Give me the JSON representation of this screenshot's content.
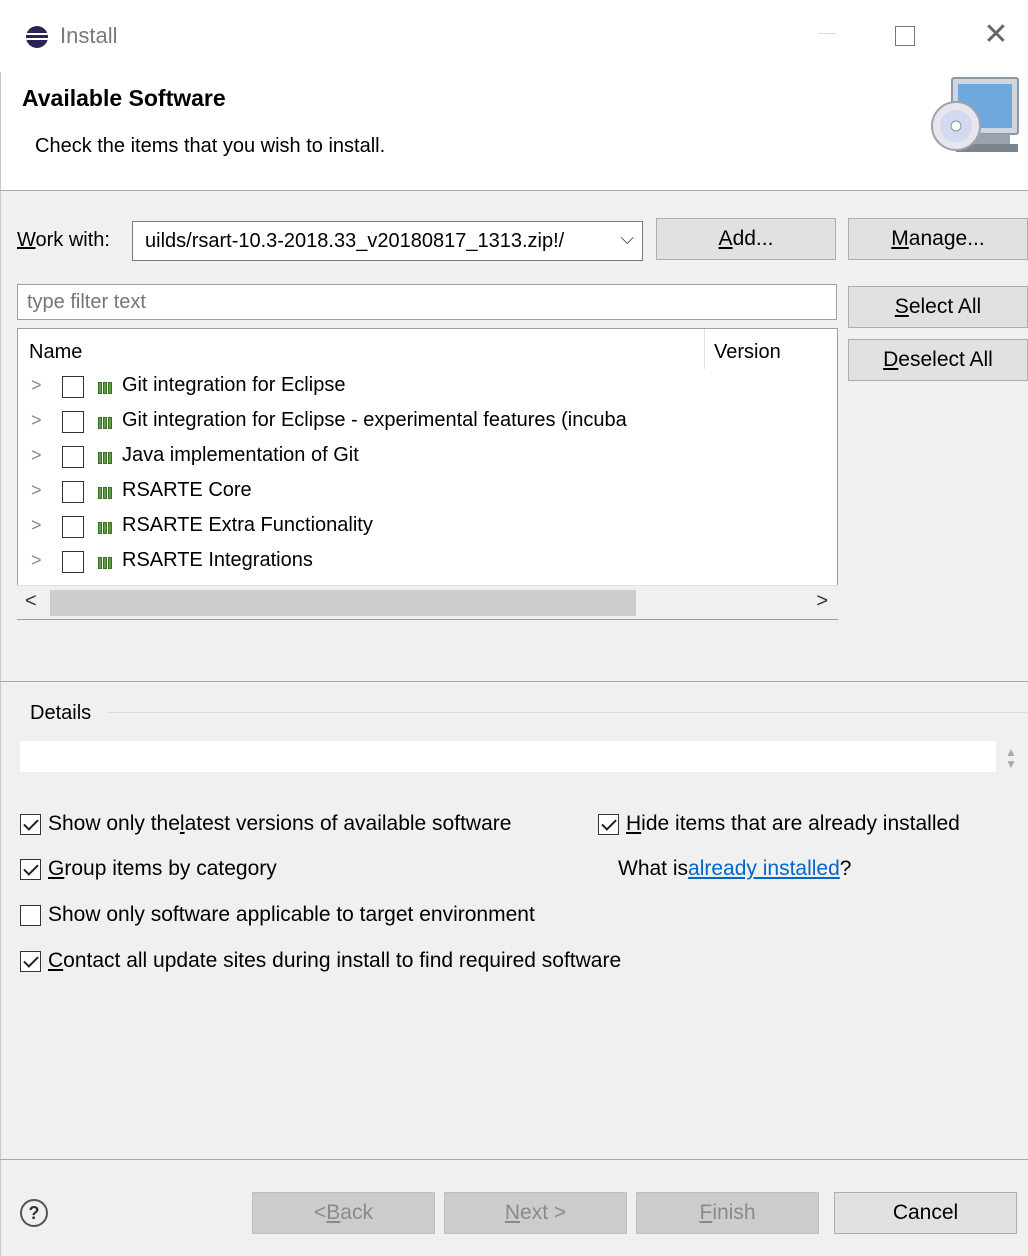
{
  "window": {
    "title": "Install",
    "close_glyph": "✕"
  },
  "header": {
    "title": "Available Software",
    "description": "Check the items that you wish to install."
  },
  "work_with": {
    "label_prefix": "W",
    "label_rest": "ork with:",
    "value": "uilds/rsart-10.3-2018.33_v20180817_1313.zip!/",
    "dropdown_glyph": "⌵"
  },
  "buttons": {
    "add": "Add...",
    "add_mnemonic": "A",
    "manage_mnemonic": "M",
    "manage_rest": "anage...",
    "select_all_mnemonic": "S",
    "select_all_rest": "elect All",
    "deselect_all_mnemonic": "D",
    "deselect_all_rest": "eselect All",
    "back_prefix": "< ",
    "back_mnemonic": "B",
    "back_rest": "ack",
    "next_mnemonic": "N",
    "next_rest": "ext >",
    "finish_mnemonic": "F",
    "finish_rest": "inish",
    "cancel": "Cancel"
  },
  "filter": {
    "placeholder": "type filter text"
  },
  "tree": {
    "columns": {
      "name": "Name",
      "version": "Version"
    },
    "expand_glyph": ">",
    "rows": [
      {
        "label": "Git integration for Eclipse",
        "checked": false
      },
      {
        "label": "Git integration for Eclipse - experimental features  (incuba",
        "checked": false
      },
      {
        "label": "Java implementation of Git",
        "checked": false
      },
      {
        "label": "RSARTE Core",
        "checked": false
      },
      {
        "label": "RSARTE Extra Functionality",
        "checked": false
      },
      {
        "label": "RSARTE Integrations",
        "checked": false
      }
    ],
    "scroll_left_glyph": "<",
    "scroll_right_glyph": ">"
  },
  "details": {
    "label": "Details"
  },
  "options": {
    "latest_pre": "Show only the ",
    "latest_mn": "l",
    "latest_post": "atest versions of available software",
    "latest_checked": true,
    "hide_mn": "H",
    "hide_post": "ide items that are already installed",
    "hide_checked": true,
    "group_mn": "G",
    "group_post": "roup items by category",
    "group_checked": true,
    "target_label": "Show only software applicable to target environment",
    "target_checked": false,
    "contact_mn": "C",
    "contact_post": "ontact all update sites during install to find required software",
    "contact_checked": true,
    "what_is_pre": "What is ",
    "what_is_link": "already installed",
    "what_is_post": "?"
  },
  "help": {
    "glyph": "?"
  }
}
